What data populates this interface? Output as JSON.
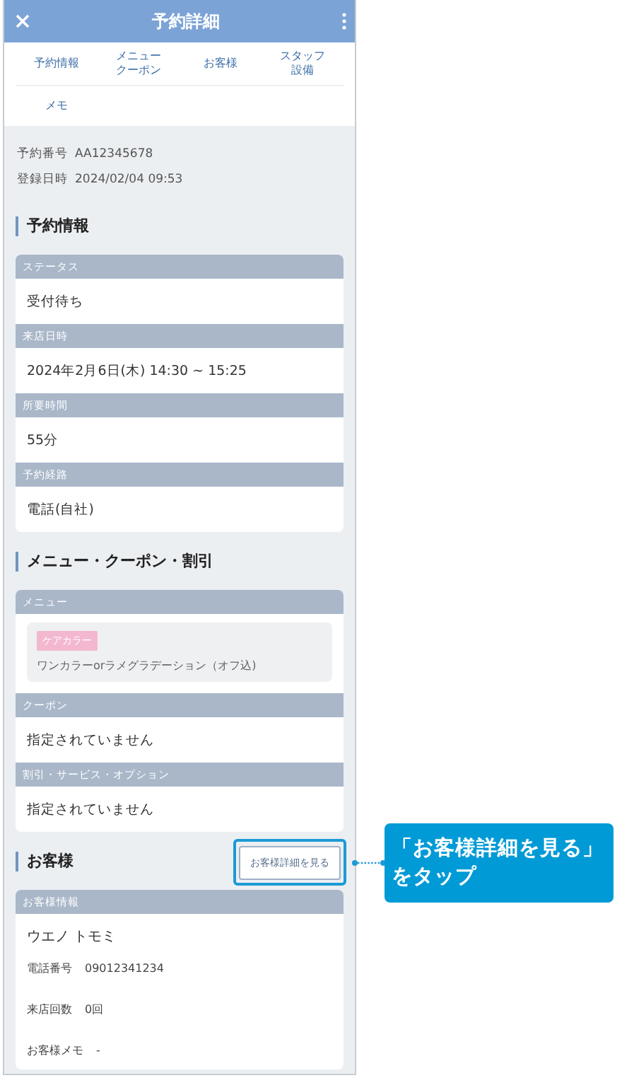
{
  "header": {
    "title": "予約詳細"
  },
  "tabs": [
    {
      "label": "予約情報"
    },
    {
      "label": "メニュークーポン"
    },
    {
      "label": "お客様"
    },
    {
      "label": "スタッフ設備"
    },
    {
      "label": "メモ"
    }
  ],
  "meta": [
    {
      "label": "予約番号",
      "value": "AA12345678"
    },
    {
      "label": "登録日時",
      "value": "2024/02/04 09:53"
    }
  ],
  "sections": [
    {
      "title": "予約情報",
      "fields": [
        {
          "kind": "text",
          "label": "ステータス",
          "value": "受付待ち"
        },
        {
          "kind": "text",
          "label": "来店日時",
          "value": "2024年2月6日(木) 14:30 ~ 15:25"
        },
        {
          "kind": "text",
          "label": "所要時間",
          "value": "55分"
        },
        {
          "kind": "text",
          "label": "予約経路",
          "value": "電話(自社)"
        }
      ]
    },
    {
      "title": "メニュー・クーポン・割引",
      "fields": [
        {
          "kind": "menu",
          "label": "メニュー",
          "tag": "ケアカラー",
          "value": "ワンカラーorラメグラデーション（オフ込)"
        },
        {
          "kind": "text",
          "label": "クーポン",
          "value": "指定されていません"
        },
        {
          "kind": "text",
          "label": "割引・サービス・オプション",
          "value": "指定されていません"
        }
      ]
    },
    {
      "title": "お客様",
      "button": "お客様詳細を見る",
      "highlighted": true,
      "fields": [
        {
          "kind": "customer",
          "label": "お客様情報",
          "value": "ウエノ トモミ",
          "rows": [
            {
              "label": "電話番号",
              "value": "09012341234"
            },
            {
              "label": "来店回数",
              "value": "0回"
            },
            {
              "label": "お客様メモ",
              "value": "-"
            }
          ]
        }
      ]
    }
  ],
  "callout": {
    "lines": [
      "「お客様詳細を見る」",
      "をタップ"
    ]
  }
}
